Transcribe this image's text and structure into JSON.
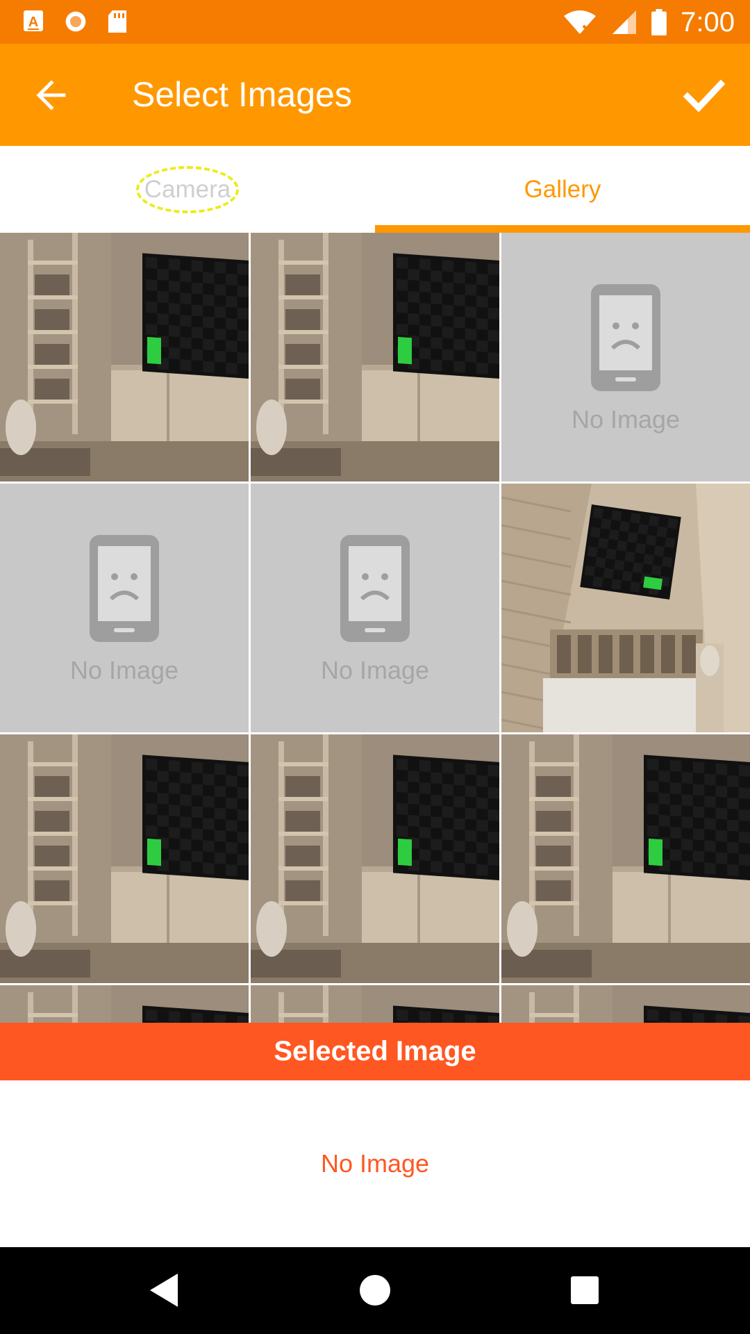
{
  "status_bar": {
    "time": "7:00",
    "left_icons": [
      "a-letter-icon",
      "circle-target-icon",
      "sd-card-icon"
    ],
    "right_icons": [
      "wifi-off-icon",
      "signal-icon",
      "battery-icon"
    ]
  },
  "app_bar": {
    "title": "Select Images",
    "back_icon": "arrow-left-icon",
    "confirm_icon": "check-icon"
  },
  "tabs": [
    {
      "label": "Camera",
      "active": false
    },
    {
      "label": "Gallery",
      "active": true
    }
  ],
  "gallery": {
    "no_image_label": "No Image",
    "cells": [
      "photo",
      "photo",
      "empty",
      "empty",
      "empty",
      "photo-rotated",
      "photo",
      "photo",
      "photo",
      "photo",
      "photo",
      "photo"
    ]
  },
  "selected": {
    "header": "Selected Image",
    "empty_text": "No Image"
  },
  "colors": {
    "status_bar": "#f57c00",
    "app_bar": "#ff9800",
    "accent": "#ff9800",
    "selected_header": "#ff5722",
    "placeholder_bg": "#c8c8c8"
  }
}
